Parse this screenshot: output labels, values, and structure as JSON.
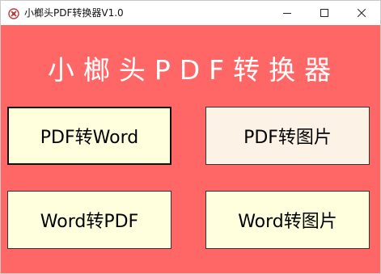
{
  "window": {
    "title": "小榔头PDF转换器V1.0",
    "icon": "hammer-app-icon",
    "controls": {
      "minimize_icon": "minimize-icon",
      "maximize_icon": "maximize-icon",
      "close_icon": "close-icon"
    }
  },
  "main": {
    "heading": "小榔头PDF转换器",
    "buttons": {
      "pdf_to_word": "PDF转Word",
      "pdf_to_image": "PDF转图片",
      "word_to_pdf": "Word转PDF",
      "word_to_image": "Word转图片"
    }
  },
  "colors": {
    "background": "#ff6666",
    "button_fill": "#ffffdd",
    "button_hover_fill": "#fcf3e6",
    "heading_text": "#ffffff"
  }
}
